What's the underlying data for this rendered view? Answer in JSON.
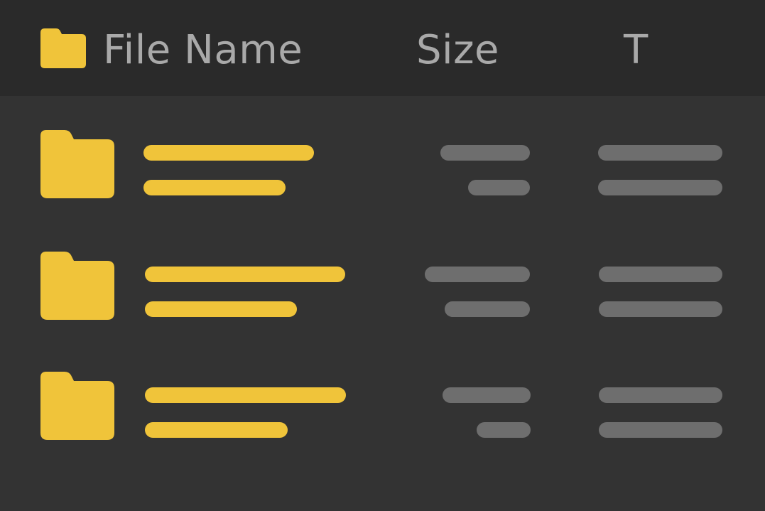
{
  "header": {
    "folder_icon": "folder-icon",
    "columns": {
      "name": "File Name",
      "size": "Size",
      "type": "T"
    }
  },
  "rows": [
    {
      "icon": "folder-icon"
    },
    {
      "icon": "folder-icon"
    },
    {
      "icon": "folder-icon"
    }
  ],
  "colors": {
    "accent": "#f0c43a",
    "placeholder": "#6e6e6e",
    "background": "#333333",
    "header_background": "#2a2a2a",
    "header_text": "#a9a9a9"
  }
}
